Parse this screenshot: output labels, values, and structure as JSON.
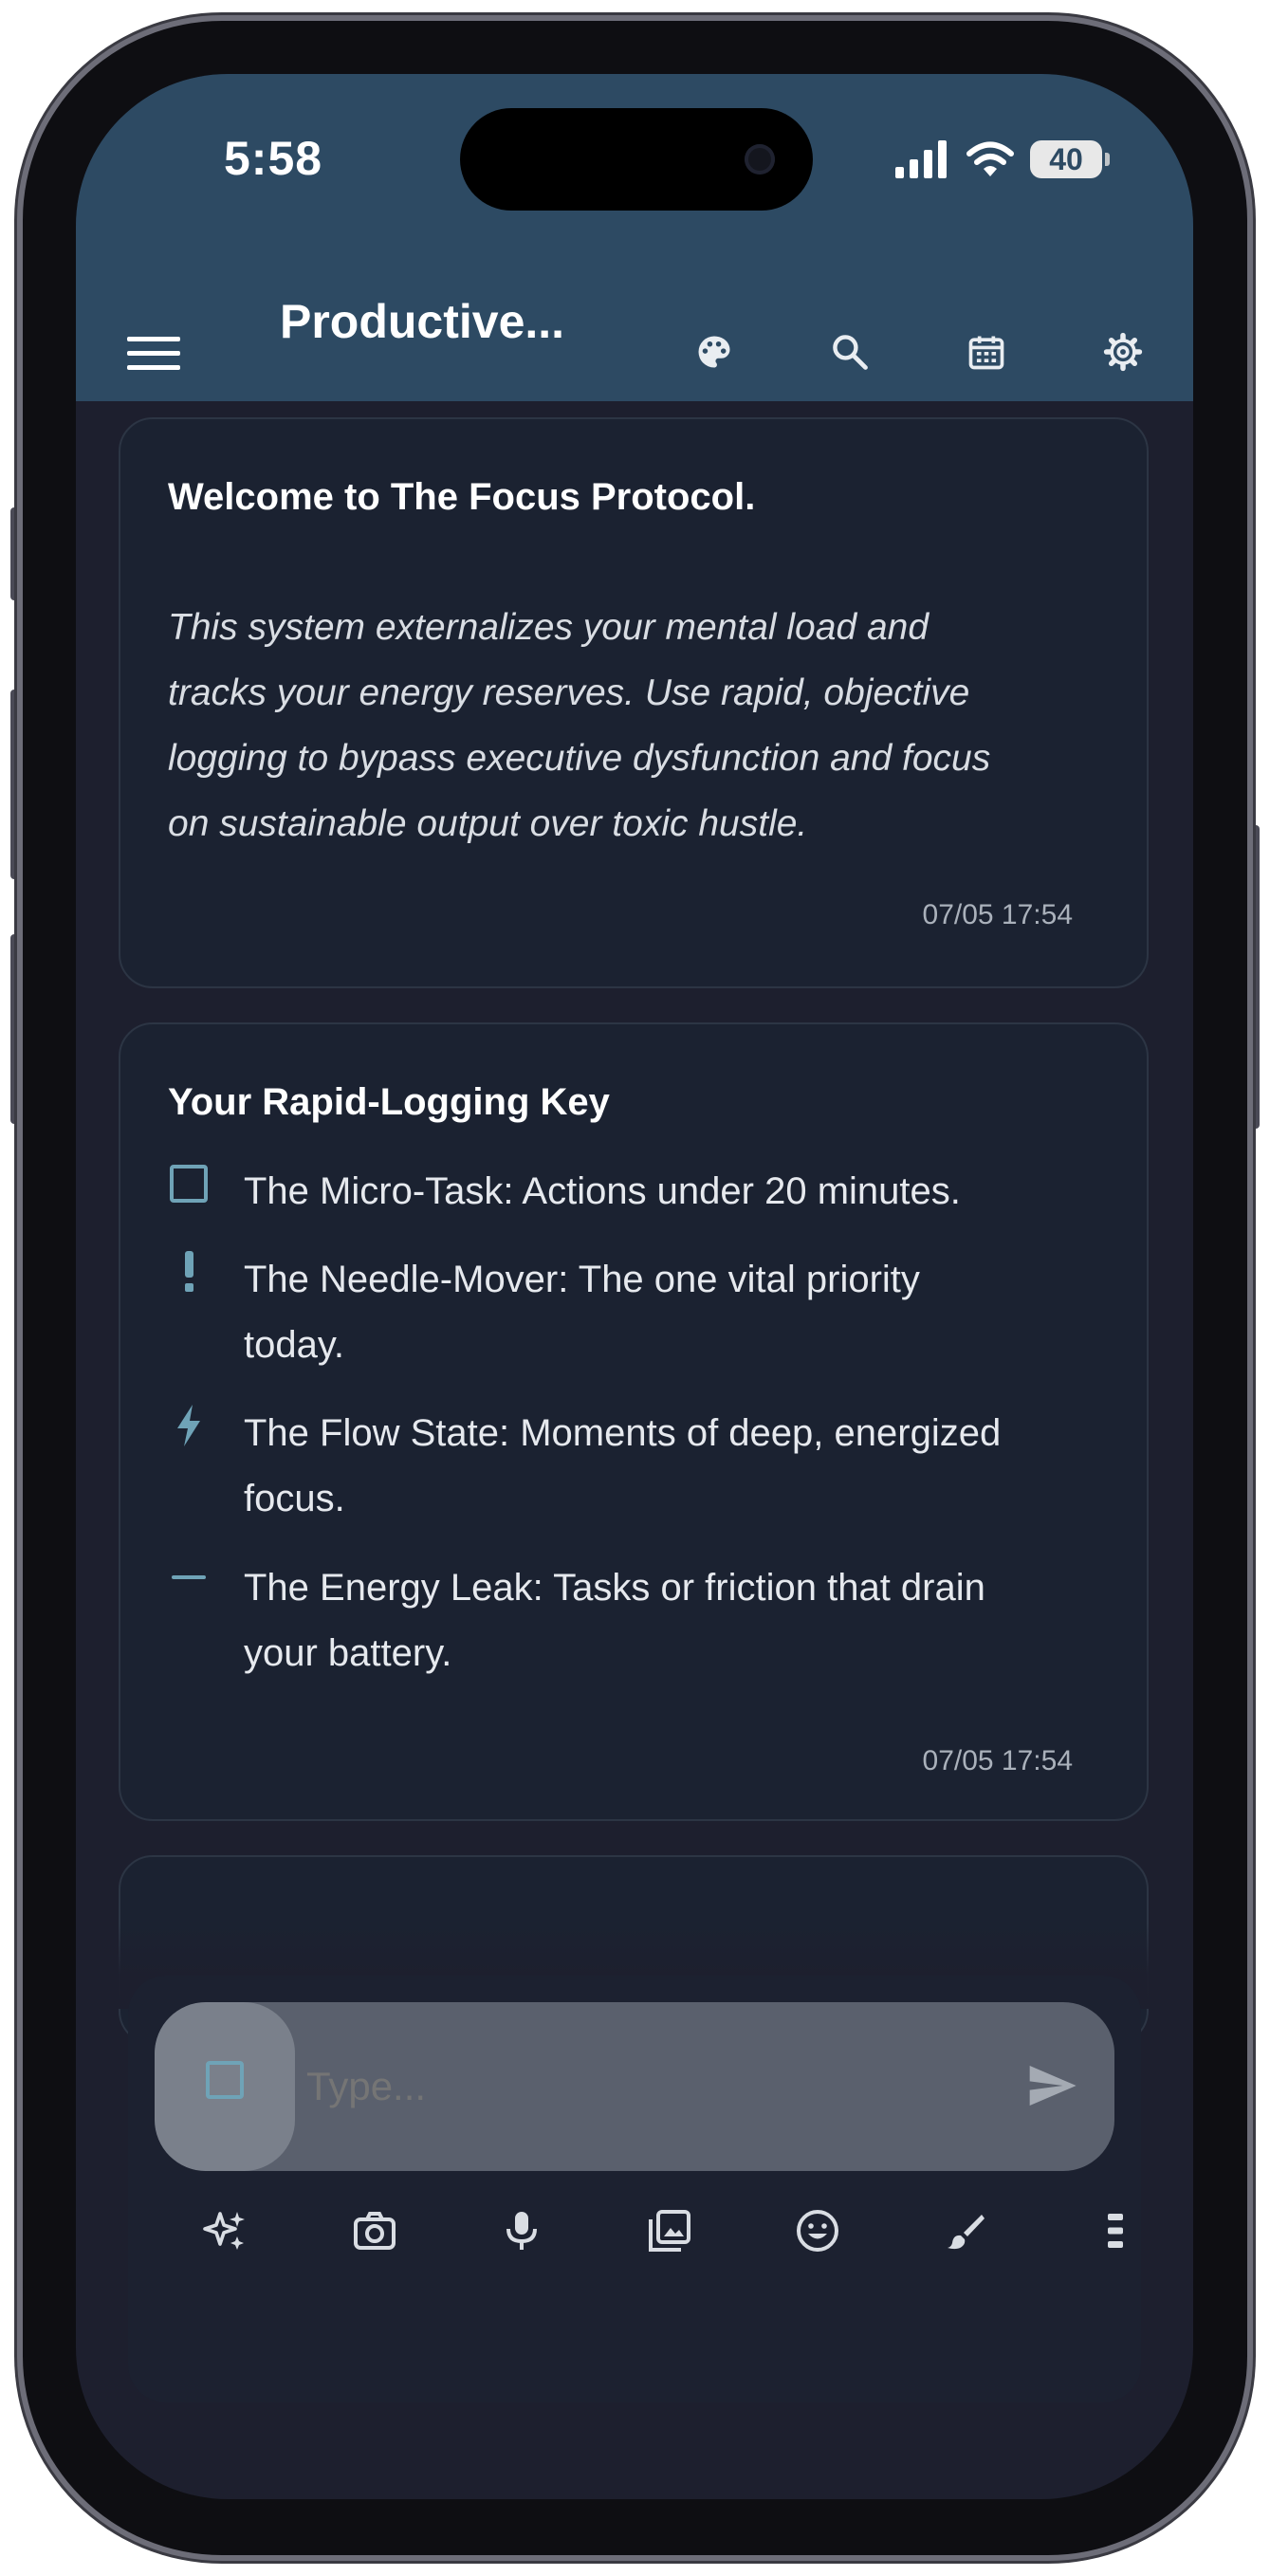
{
  "status_bar": {
    "time": "5:58",
    "battery_level": "40",
    "icons": [
      "signal-icon",
      "wifi-icon",
      "battery-icon"
    ]
  },
  "app_bar": {
    "title": "Productive...",
    "icons": [
      "menu-icon",
      "palette-icon",
      "search-icon",
      "calendar-icon",
      "settings-icon"
    ]
  },
  "colors": {
    "app_bar_bg": "#2d4a63",
    "screen_bg": "#1d1f2e",
    "card_bg": "#1b2231",
    "accent": "#6fa3b7"
  },
  "entries": [
    {
      "title": "Welcome to The Focus Protocol.",
      "body_lines": [
        "This system externalizes your mental load and",
        "tracks your energy reserves. Use rapid, objective",
        "logging to bypass executive dysfunction and focus",
        "on sustainable output over toxic hustle."
      ],
      "timestamp": "07/05 17:54"
    },
    {
      "title": "Your Rapid-Logging Key",
      "key_items": [
        {
          "icon": "checkbox-icon",
          "lines": [
            "The Micro-Task: Actions under 20 minutes."
          ]
        },
        {
          "icon": "exclamation-icon",
          "lines": [
            "The Needle-Mover: The one vital priority",
            "today."
          ]
        },
        {
          "icon": "lightning-icon",
          "lines": [
            "The Flow State: Moments of deep, energized",
            "focus."
          ]
        },
        {
          "icon": "dash-icon",
          "lines": [
            "The Energy Leak: Tasks or friction that drain",
            "your battery."
          ]
        }
      ],
      "timestamp": "07/05 17:54"
    }
  ],
  "composer": {
    "placeholder": "Type...",
    "type_selector_icon": "checkbox-icon",
    "send_icon": "send-icon",
    "toolbar_icons": [
      "sparkle-icon",
      "camera-icon",
      "microphone-icon",
      "gallery-icon",
      "emoji-icon",
      "brush-icon",
      "more-icon"
    ]
  }
}
